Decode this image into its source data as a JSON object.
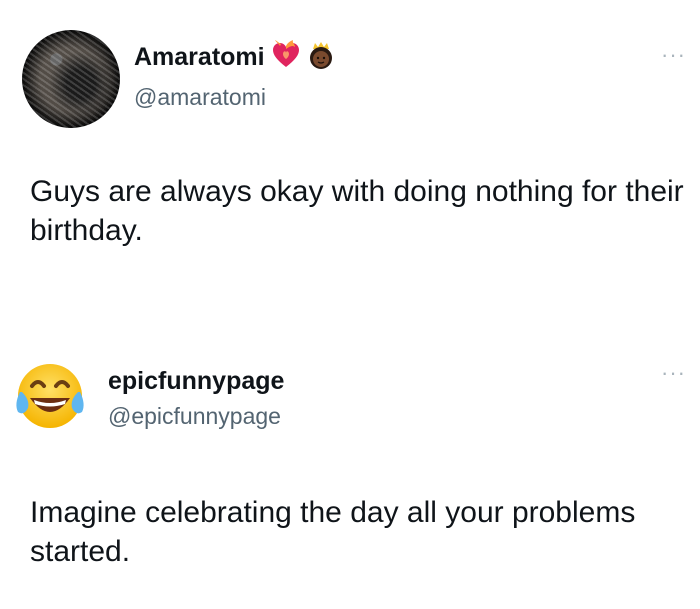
{
  "tweets": [
    {
      "display_name": "Amaratomi",
      "handle": "@amaratomi",
      "badges": [
        "heart-on-fire-emoji",
        "princess-emoji"
      ],
      "text": "Guys are always okay with doing nothing for their birthday.",
      "more_label": "···"
    },
    {
      "display_name": "epicfunnypage",
      "handle": "@epicfunnypage",
      "avatar": "tears-of-joy-emoji",
      "text": "Imagine celebrating the day all your problems started.",
      "more_label": "···"
    }
  ],
  "colors": {
    "name": "#0f1419",
    "handle": "#536471",
    "more": "#a9b4bc",
    "emoji_yellow": "#ffcc33",
    "heart_red": "#e0245e"
  }
}
